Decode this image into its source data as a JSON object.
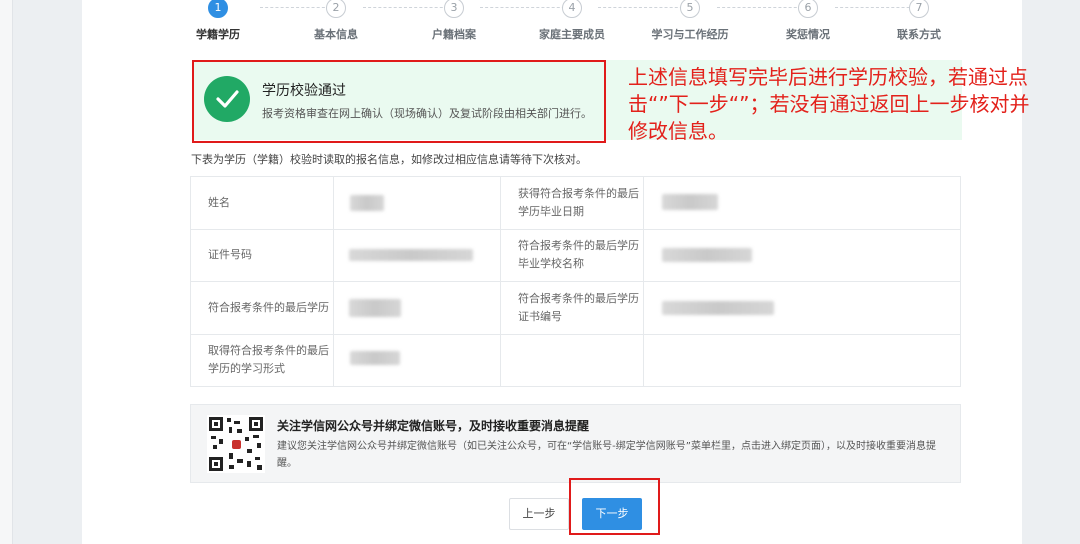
{
  "steps": [
    {
      "num": "1",
      "label": "学籍学历",
      "active": true
    },
    {
      "num": "2",
      "label": "基本信息",
      "active": false
    },
    {
      "num": "3",
      "label": "户籍档案",
      "active": false
    },
    {
      "num": "4",
      "label": "家庭主要成员",
      "active": false
    },
    {
      "num": "5",
      "label": "学习与工作经历",
      "active": false
    },
    {
      "num": "6",
      "label": "奖惩情况",
      "active": false
    },
    {
      "num": "7",
      "label": "联系方式",
      "active": false
    }
  ],
  "banner": {
    "title": "学历校验通过",
    "desc": "报考资格审查在网上确认（现场确认）及复试阶段由相关部门进行。"
  },
  "annotation": "上述信息填写完毕后进行学历校验，若通过点击“”下一步“”；若没有通过返回上一步核对并修改信息。",
  "note": "下表为学历（学籍）校验时读取的报名信息，如修改过相应信息请等待下次核对。",
  "table": {
    "rows": [
      {
        "left_label": "姓名",
        "right_label": "获得符合报考条件的最后学历毕业日期"
      },
      {
        "left_label": "证件号码",
        "right_label": "符合报考条件的最后学历毕业学校名称"
      },
      {
        "left_label": "符合报考条件的最后学历",
        "right_label": "符合报考条件的最后学历证书编号"
      },
      {
        "left_label": "取得符合报考条件的最后学历的学习形式",
        "right_label": ""
      }
    ]
  },
  "wechat": {
    "title": "关注学信网公众号并绑定微信账号，及时接收重要消息提醒",
    "desc": "建议您关注学信网公众号并绑定微信账号（如已关注公众号，可在“学信账号-绑定学信网账号”菜单栏里，点击进入绑定页面），以及时接收重要消息提醒。"
  },
  "buttons": {
    "prev": "上一步",
    "next": "下一步"
  },
  "colors": {
    "accent": "#2f8fe3",
    "success": "#21a965",
    "annotation_red": "#e3211b"
  }
}
